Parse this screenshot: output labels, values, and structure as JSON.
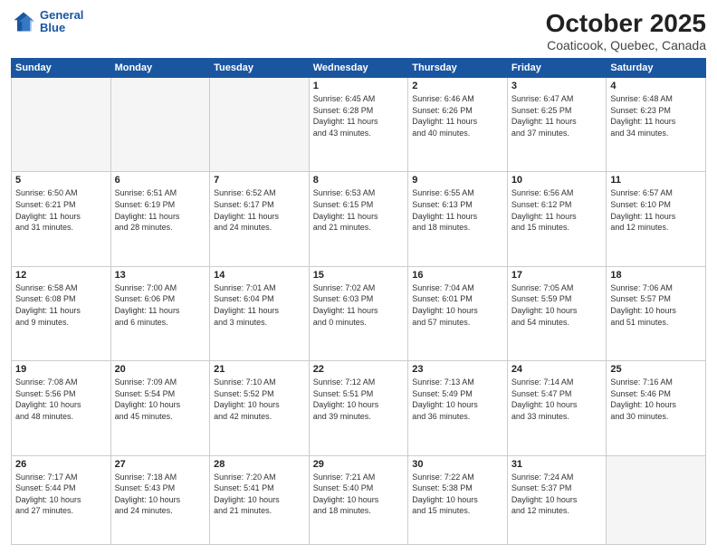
{
  "header": {
    "logo_line1": "General",
    "logo_line2": "Blue",
    "month": "October 2025",
    "location": "Coaticook, Quebec, Canada"
  },
  "weekdays": [
    "Sunday",
    "Monday",
    "Tuesday",
    "Wednesday",
    "Thursday",
    "Friday",
    "Saturday"
  ],
  "weeks": [
    [
      {
        "day": "",
        "info": ""
      },
      {
        "day": "",
        "info": ""
      },
      {
        "day": "",
        "info": ""
      },
      {
        "day": "1",
        "info": "Sunrise: 6:45 AM\nSunset: 6:28 PM\nDaylight: 11 hours\nand 43 minutes."
      },
      {
        "day": "2",
        "info": "Sunrise: 6:46 AM\nSunset: 6:26 PM\nDaylight: 11 hours\nand 40 minutes."
      },
      {
        "day": "3",
        "info": "Sunrise: 6:47 AM\nSunset: 6:25 PM\nDaylight: 11 hours\nand 37 minutes."
      },
      {
        "day": "4",
        "info": "Sunrise: 6:48 AM\nSunset: 6:23 PM\nDaylight: 11 hours\nand 34 minutes."
      }
    ],
    [
      {
        "day": "5",
        "info": "Sunrise: 6:50 AM\nSunset: 6:21 PM\nDaylight: 11 hours\nand 31 minutes."
      },
      {
        "day": "6",
        "info": "Sunrise: 6:51 AM\nSunset: 6:19 PM\nDaylight: 11 hours\nand 28 minutes."
      },
      {
        "day": "7",
        "info": "Sunrise: 6:52 AM\nSunset: 6:17 PM\nDaylight: 11 hours\nand 24 minutes."
      },
      {
        "day": "8",
        "info": "Sunrise: 6:53 AM\nSunset: 6:15 PM\nDaylight: 11 hours\nand 21 minutes."
      },
      {
        "day": "9",
        "info": "Sunrise: 6:55 AM\nSunset: 6:13 PM\nDaylight: 11 hours\nand 18 minutes."
      },
      {
        "day": "10",
        "info": "Sunrise: 6:56 AM\nSunset: 6:12 PM\nDaylight: 11 hours\nand 15 minutes."
      },
      {
        "day": "11",
        "info": "Sunrise: 6:57 AM\nSunset: 6:10 PM\nDaylight: 11 hours\nand 12 minutes."
      }
    ],
    [
      {
        "day": "12",
        "info": "Sunrise: 6:58 AM\nSunset: 6:08 PM\nDaylight: 11 hours\nand 9 minutes."
      },
      {
        "day": "13",
        "info": "Sunrise: 7:00 AM\nSunset: 6:06 PM\nDaylight: 11 hours\nand 6 minutes."
      },
      {
        "day": "14",
        "info": "Sunrise: 7:01 AM\nSunset: 6:04 PM\nDaylight: 11 hours\nand 3 minutes."
      },
      {
        "day": "15",
        "info": "Sunrise: 7:02 AM\nSunset: 6:03 PM\nDaylight: 11 hours\nand 0 minutes."
      },
      {
        "day": "16",
        "info": "Sunrise: 7:04 AM\nSunset: 6:01 PM\nDaylight: 10 hours\nand 57 minutes."
      },
      {
        "day": "17",
        "info": "Sunrise: 7:05 AM\nSunset: 5:59 PM\nDaylight: 10 hours\nand 54 minutes."
      },
      {
        "day": "18",
        "info": "Sunrise: 7:06 AM\nSunset: 5:57 PM\nDaylight: 10 hours\nand 51 minutes."
      }
    ],
    [
      {
        "day": "19",
        "info": "Sunrise: 7:08 AM\nSunset: 5:56 PM\nDaylight: 10 hours\nand 48 minutes."
      },
      {
        "day": "20",
        "info": "Sunrise: 7:09 AM\nSunset: 5:54 PM\nDaylight: 10 hours\nand 45 minutes."
      },
      {
        "day": "21",
        "info": "Sunrise: 7:10 AM\nSunset: 5:52 PM\nDaylight: 10 hours\nand 42 minutes."
      },
      {
        "day": "22",
        "info": "Sunrise: 7:12 AM\nSunset: 5:51 PM\nDaylight: 10 hours\nand 39 minutes."
      },
      {
        "day": "23",
        "info": "Sunrise: 7:13 AM\nSunset: 5:49 PM\nDaylight: 10 hours\nand 36 minutes."
      },
      {
        "day": "24",
        "info": "Sunrise: 7:14 AM\nSunset: 5:47 PM\nDaylight: 10 hours\nand 33 minutes."
      },
      {
        "day": "25",
        "info": "Sunrise: 7:16 AM\nSunset: 5:46 PM\nDaylight: 10 hours\nand 30 minutes."
      }
    ],
    [
      {
        "day": "26",
        "info": "Sunrise: 7:17 AM\nSunset: 5:44 PM\nDaylight: 10 hours\nand 27 minutes."
      },
      {
        "day": "27",
        "info": "Sunrise: 7:18 AM\nSunset: 5:43 PM\nDaylight: 10 hours\nand 24 minutes."
      },
      {
        "day": "28",
        "info": "Sunrise: 7:20 AM\nSunset: 5:41 PM\nDaylight: 10 hours\nand 21 minutes."
      },
      {
        "day": "29",
        "info": "Sunrise: 7:21 AM\nSunset: 5:40 PM\nDaylight: 10 hours\nand 18 minutes."
      },
      {
        "day": "30",
        "info": "Sunrise: 7:22 AM\nSunset: 5:38 PM\nDaylight: 10 hours\nand 15 minutes."
      },
      {
        "day": "31",
        "info": "Sunrise: 7:24 AM\nSunset: 5:37 PM\nDaylight: 10 hours\nand 12 minutes."
      },
      {
        "day": "",
        "info": ""
      }
    ]
  ]
}
